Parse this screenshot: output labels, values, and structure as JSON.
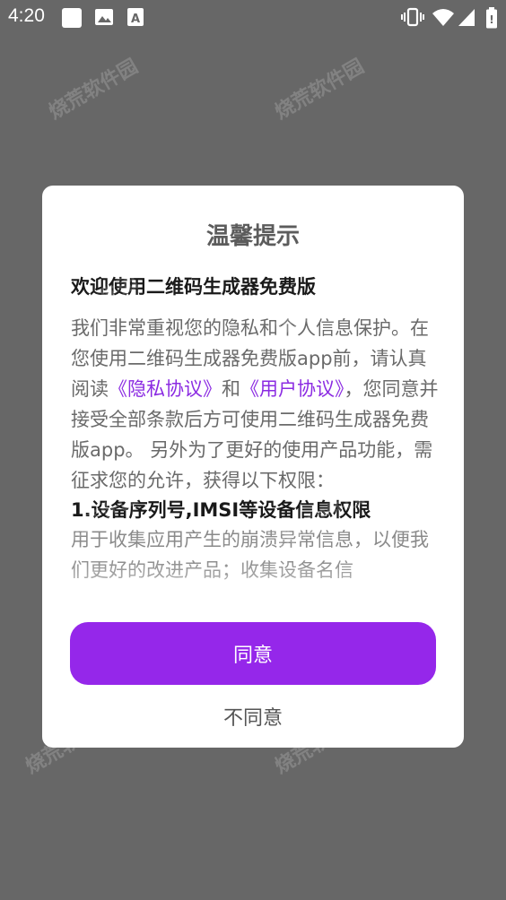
{
  "status_bar": {
    "time": "4:20",
    "left_icons": [
      "square-notification-icon",
      "image-icon",
      "font-a-icon"
    ],
    "right_icons": [
      "vibrate-icon",
      "wifi-icon",
      "signal-icon",
      "battery-icon"
    ]
  },
  "watermark": "烧荒软件园",
  "dialog": {
    "title": "温馨提示",
    "heading": "欢迎使用二维码生成器免费版",
    "para_part1": "我们非常重视您的隐私和个人信息保护。在您使用二维码生成器免费版app前，请认真阅读",
    "privacy_link": "《隐私协议》",
    "and_text": "和",
    "user_link": "《用户协议》",
    "para_part2": "，您同意并接受全部条款后方可使用二维码生成器免费版app。 另外为了更好的使用产品功能，需征求您的允许，获得以下权限：",
    "permission_title": "1.设备序列号,IMSI等设备信息权限",
    "permission_desc": "用于收集应用产生的崩溃异常信息，以便我们更好的改进产品；收集设备名信",
    "agree_label": "同意",
    "disagree_label": "不同意"
  },
  "colors": {
    "accent": "#9527ea",
    "link": "#8b2be2",
    "overlay": "#676767"
  }
}
